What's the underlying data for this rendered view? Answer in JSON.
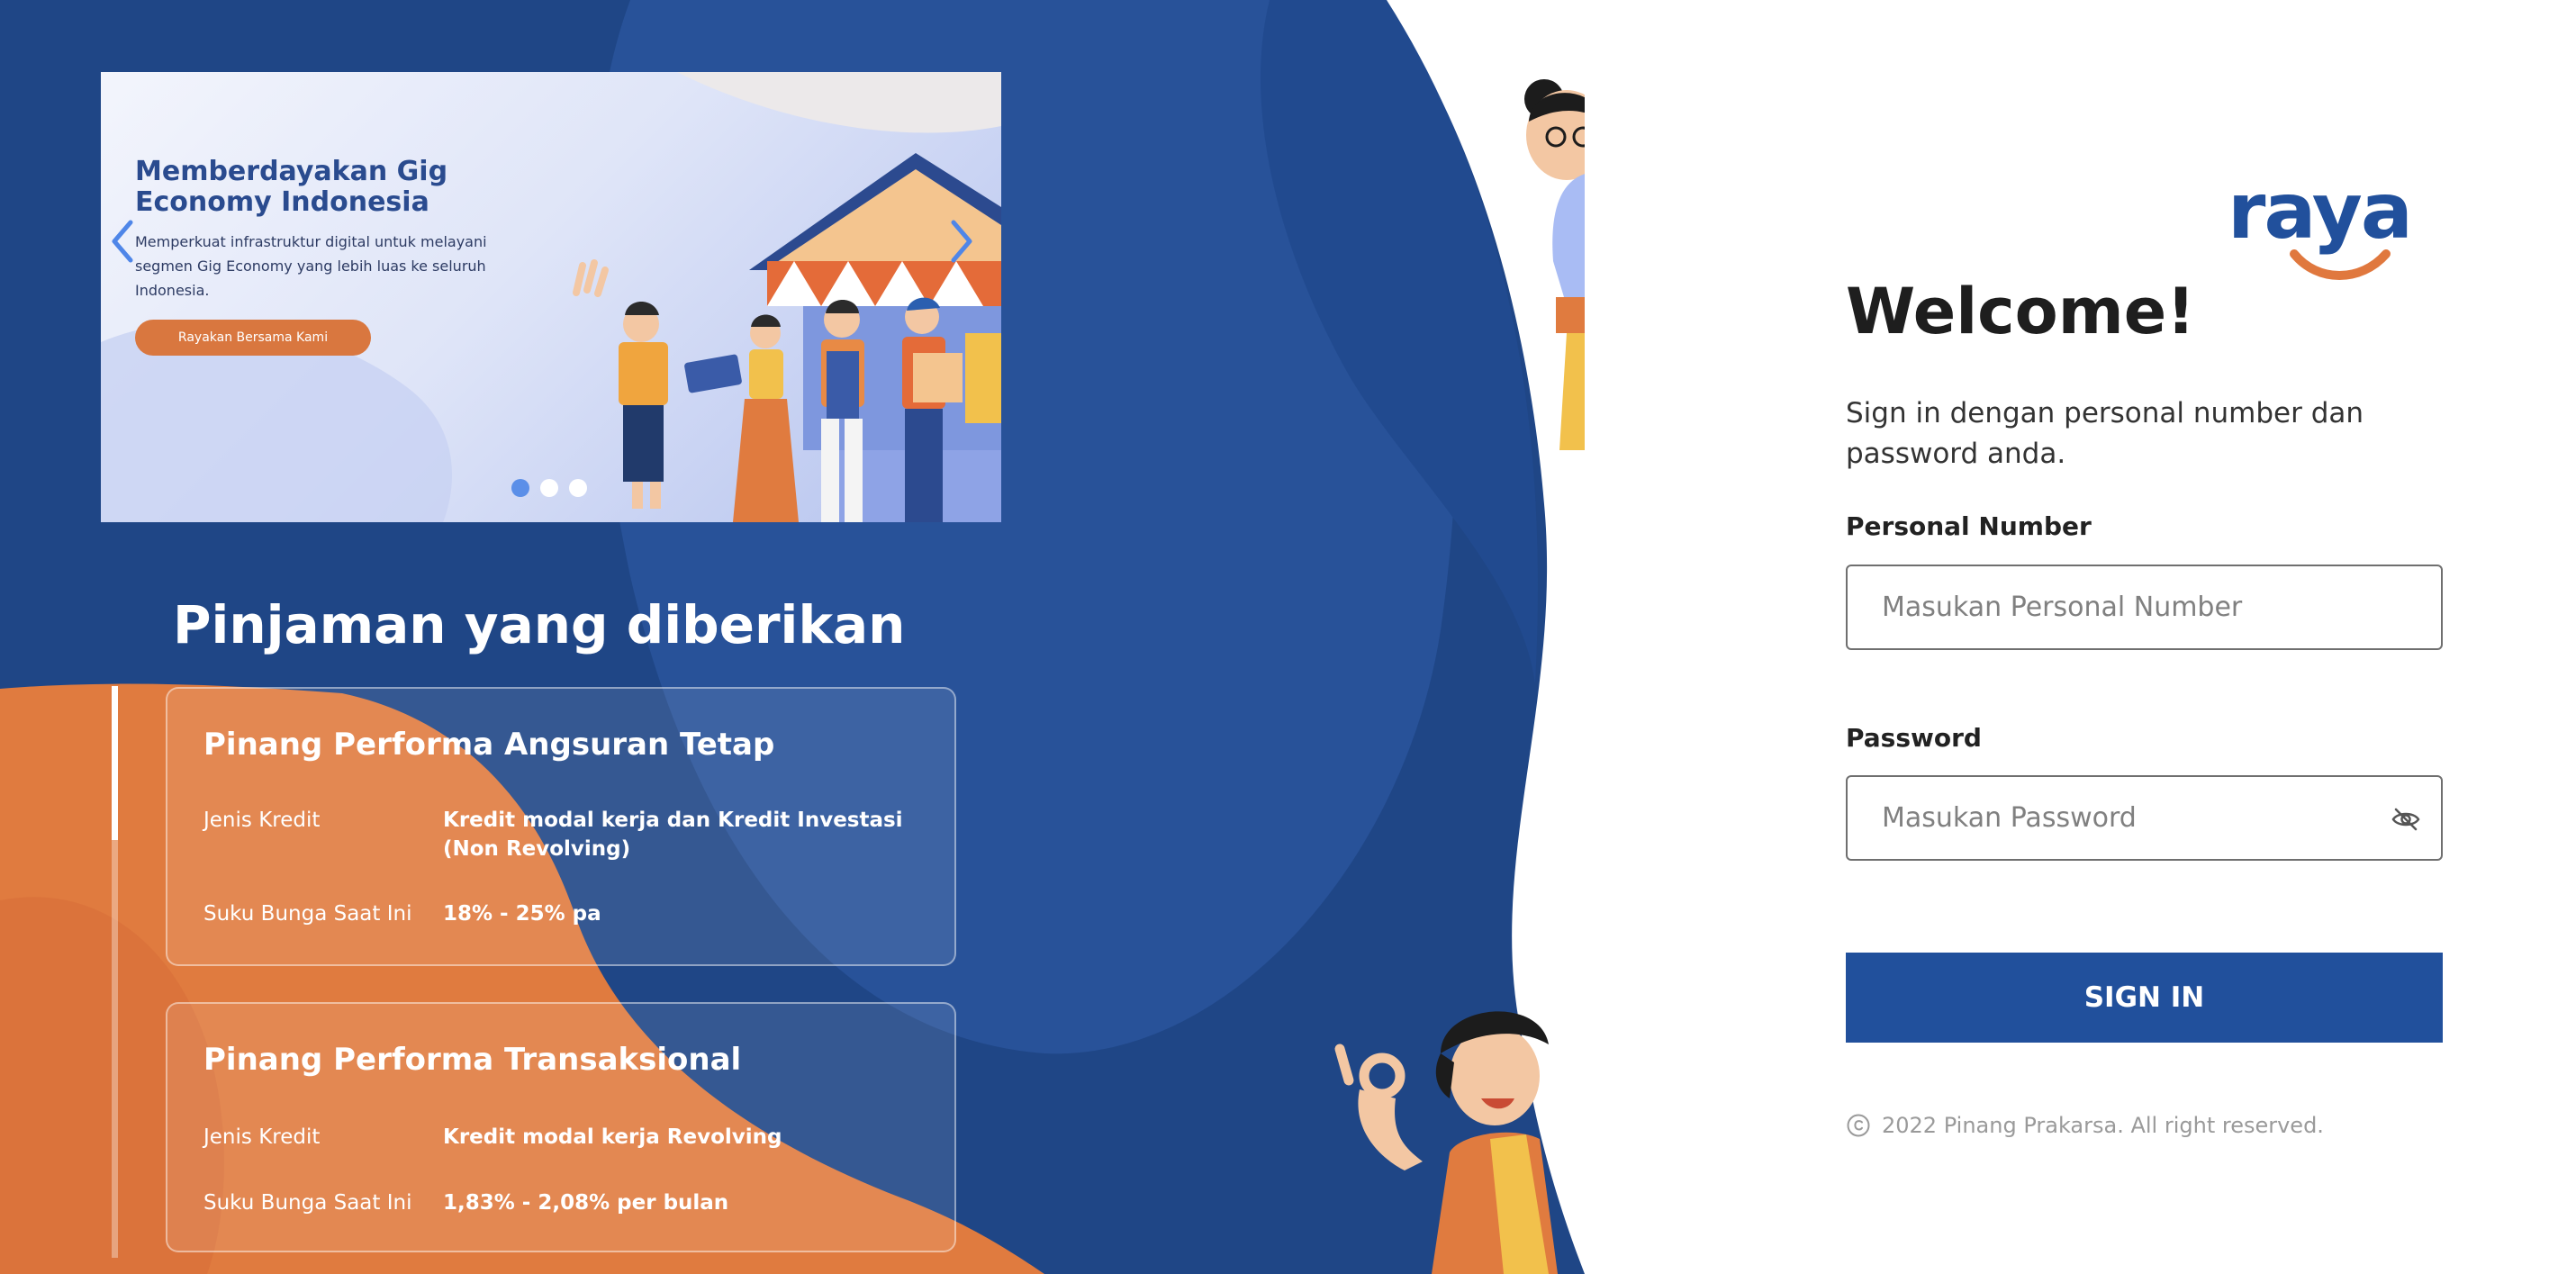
{
  "carousel": {
    "title": "Memberdayakan Gig Economy Indonesia",
    "description": "Memperkuat infrastruktur digital untuk melayani segmen Gig Economy yang lebih luas ke seluruh Indonesia.",
    "cta_label": "Rayakan Bersama Kami",
    "slide_count": 3,
    "active_slide": 1,
    "prev_icon": "chevron-left-icon",
    "next_icon": "chevron-right-icon"
  },
  "loans": {
    "heading": "Pinjaman yang diberikan",
    "items": [
      {
        "title": "Pinang Performa Angsuran Tetap",
        "credit_type_label": "Jenis Kredit",
        "credit_type_value": "Kredit modal kerja dan Kredit Investasi (Non Revolving)",
        "rate_label": "Suku Bunga Saat Ini",
        "rate_value": "18% - 25% pa"
      },
      {
        "title": "Pinang Performa Transaksional",
        "credit_type_label": "Jenis Kredit",
        "credit_type_value": "Kredit modal kerja Revolving",
        "rate_label": "Suku Bunga Saat Ini",
        "rate_value": "1,83% - 2,08% per bulan"
      }
    ],
    "scroll_progress": 0.27
  },
  "brand": {
    "logo_text": "raya",
    "primary_color": "#21509c",
    "accent_color": "#e0783e"
  },
  "login": {
    "title": "Welcome!",
    "subtitle": "Sign in dengan personal number dan password anda.",
    "personal_number_label": "Personal Number",
    "personal_number_placeholder": "Masukan Personal Number",
    "personal_number_value": "",
    "password_label": "Password",
    "password_placeholder": "Masukan Password",
    "password_value": "",
    "password_toggle_icon": "eye-off-icon",
    "submit_label": "SIGN IN"
  },
  "footer": {
    "copyright_icon": "copyright-icon",
    "text": "2022 Pinang Prakarsa. All right reserved."
  }
}
